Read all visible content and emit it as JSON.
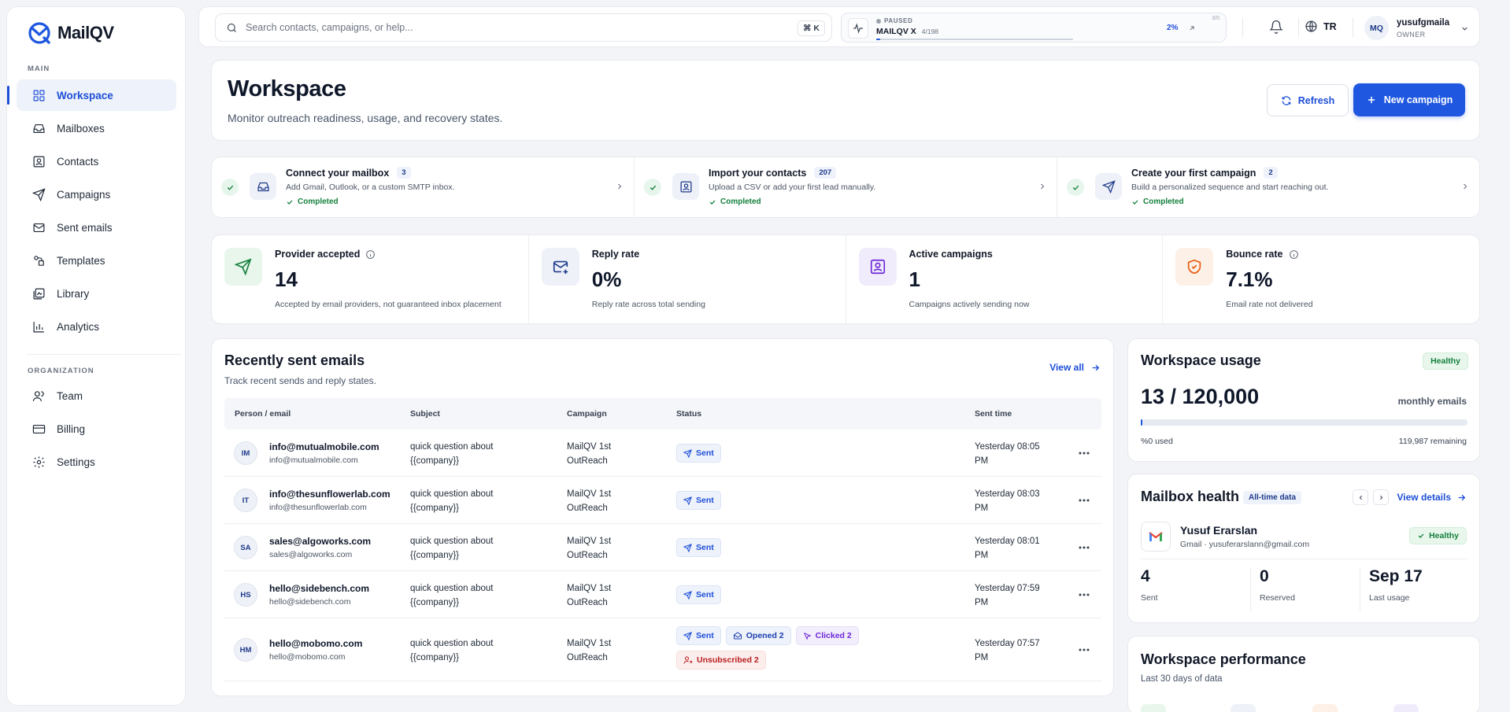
{
  "app": {
    "name": "MailQV"
  },
  "sidebar": {
    "main_label": "MAIN",
    "org_label": "ORGANIZATION",
    "main_items": [
      {
        "label": "Workspace",
        "icon": "grid-icon"
      },
      {
        "label": "Mailboxes",
        "icon": "inbox-icon"
      },
      {
        "label": "Contacts",
        "icon": "contact-card-icon"
      },
      {
        "label": "Campaigns",
        "icon": "send-icon"
      },
      {
        "label": "Sent emails",
        "icon": "mail-icon"
      },
      {
        "label": "Templates",
        "icon": "template-icon"
      },
      {
        "label": "Library",
        "icon": "library-icon"
      },
      {
        "label": "Analytics",
        "icon": "bar-chart-icon"
      }
    ],
    "org_items": [
      {
        "label": "Team",
        "icon": "users-icon"
      },
      {
        "label": "Billing",
        "icon": "credit-card-icon"
      },
      {
        "label": "Settings",
        "icon": "gear-icon"
      }
    ]
  },
  "topbar": {
    "search_placeholder": "Search contacts, campaigns, or help...",
    "shortcut": "⌘ K",
    "campaign_status": {
      "state": "PAUSED",
      "name": "MAILQV X",
      "count": "4/198",
      "progress_label": "2%",
      "progress": 0.02,
      "counter": "3/0"
    },
    "language": "TR",
    "user": {
      "initials": "MQ",
      "name": "yusufgmaila",
      "role": "OWNER"
    }
  },
  "hero": {
    "title": "Workspace",
    "subtitle": "Monitor outreach readiness, usage, and recovery states.",
    "refresh_label": "Refresh",
    "new_campaign_label": "New campaign"
  },
  "steps": [
    {
      "title": "Connect your mailbox",
      "count": "3",
      "desc": "Add Gmail, Outlook, or a custom SMTP inbox.",
      "status": "Completed"
    },
    {
      "title": "Import your contacts",
      "count": "207",
      "desc": "Upload a CSV or add your first lead manually.",
      "status": "Completed"
    },
    {
      "title": "Create your first campaign",
      "count": "2",
      "desc": "Build a personalized sequence and start reaching out.",
      "status": "Completed"
    }
  ],
  "stats": [
    {
      "label": "Provider accepted",
      "value": "14",
      "sub": "Accepted by email providers, not guaranteed inbox placement"
    },
    {
      "label": "Reply rate",
      "value": "0%",
      "sub": "Reply rate across total sending"
    },
    {
      "label": "Active campaigns",
      "value": "1",
      "sub": "Campaigns actively sending now"
    },
    {
      "label": "Bounce rate",
      "value": "7.1%",
      "sub": "Email rate not delivered"
    }
  ],
  "recent": {
    "title": "Recently sent emails",
    "subtitle": "Track recent sends and reply states.",
    "view_all": "View all",
    "columns": [
      "Person / email",
      "Subject",
      "Campaign",
      "Status",
      "Sent time"
    ],
    "rows": [
      {
        "initials": "IM",
        "name": "info@mutualmobile.com",
        "email": "info@mutualmobile.com",
        "subject1": "quick question about",
        "subject2": "{{company}}",
        "campaign1": "MailQV 1st",
        "campaign2": "OutReach",
        "sent": "Sent",
        "time1": "Yesterday 08:05",
        "time2": "PM"
      },
      {
        "initials": "IT",
        "name": "info@thesunflowerlab.com",
        "email": "info@thesunflowerlab.com",
        "subject1": "quick question about",
        "subject2": "{{company}}",
        "campaign1": "MailQV 1st",
        "campaign2": "OutReach",
        "sent": "Sent",
        "time1": "Yesterday 08:03",
        "time2": "PM"
      },
      {
        "initials": "SA",
        "name": "sales@algoworks.com",
        "email": "sales@algoworks.com",
        "subject1": "quick question about",
        "subject2": "{{company}}",
        "campaign1": "MailQV 1st",
        "campaign2": "OutReach",
        "sent": "Sent",
        "time1": "Yesterday 08:01",
        "time2": "PM"
      },
      {
        "initials": "HS",
        "name": "hello@sidebench.com",
        "email": "hello@sidebench.com",
        "subject1": "quick question about",
        "subject2": "{{company}}",
        "campaign1": "MailQV 1st",
        "campaign2": "OutReach",
        "sent": "Sent",
        "time1": "Yesterday 07:59",
        "time2": "PM"
      },
      {
        "initials": "HM",
        "name": "hello@mobomo.com",
        "email": "hello@mobomo.com",
        "subject1": "quick question about",
        "subject2": "{{company}}",
        "campaign1": "MailQV 1st",
        "campaign2": "OutReach",
        "sent": "Sent",
        "opened": "Opened 2",
        "clicked": "Clicked 2",
        "unsubscribed": "Unsubscribed 2",
        "time1": "Yesterday 07:57",
        "time2": "PM"
      }
    ]
  },
  "usage": {
    "title": "Workspace usage",
    "badge": "Healthy",
    "value": "13 / 120,000",
    "unit": "monthly emails",
    "used_fraction": 0.0001,
    "used": "%0 used",
    "remaining": "119,987 remaining"
  },
  "mailbox": {
    "title": "Mailbox health",
    "tag": "All-time data",
    "view_details": "View details",
    "name": "Yusuf Erarslan",
    "provider": "Gmail · yusuferarslann@gmail.com",
    "badge": "Healthy",
    "stats": [
      {
        "value": "4",
        "label": "Sent"
      },
      {
        "value": "0",
        "label": "Reserved"
      },
      {
        "value": "Sep 17",
        "label": "Last usage"
      }
    ]
  },
  "performance": {
    "title": "Workspace performance",
    "subtitle": "Last 30 days of data"
  },
  "colors": {
    "accent": "#1f57e0",
    "success": "#15803d",
    "danger": "#b91c1c"
  }
}
